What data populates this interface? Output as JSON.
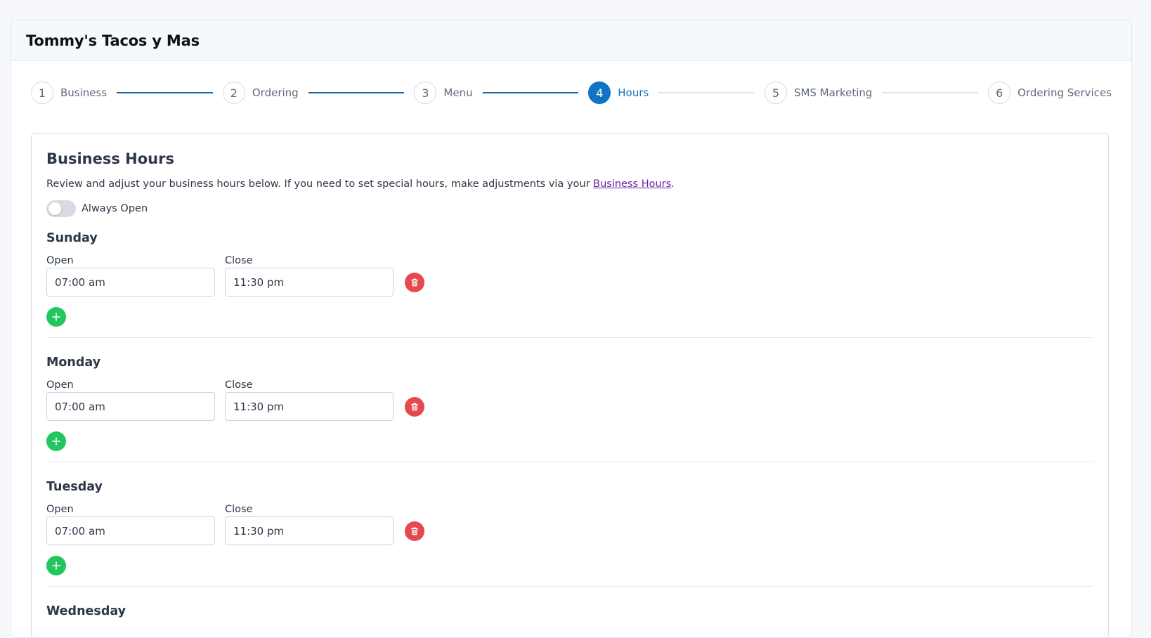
{
  "header": {
    "title": "Tommy's Tacos y Mas"
  },
  "stepper": {
    "steps": [
      {
        "num": "1",
        "label": "Business"
      },
      {
        "num": "2",
        "label": "Ordering"
      },
      {
        "num": "3",
        "label": "Menu"
      },
      {
        "num": "4",
        "label": "Hours"
      },
      {
        "num": "5",
        "label": "SMS Marketing"
      },
      {
        "num": "6",
        "label": "Ordering Services"
      }
    ],
    "active_step": 4
  },
  "card": {
    "title": "Business Hours",
    "description_before": "Review and adjust your business hours below. If you need to set special hours, make adjustments via your ",
    "description_link": "Business Hours",
    "description_after": ".",
    "always_open_label": "Always Open",
    "always_open_on": false,
    "open_label": "Open",
    "close_label": "Close",
    "days": [
      {
        "name": "Sunday",
        "open": "07:00 am",
        "close": "11:30 pm"
      },
      {
        "name": "Monday",
        "open": "07:00 am",
        "close": "11:30 pm"
      },
      {
        "name": "Tuesday",
        "open": "07:00 am",
        "close": "11:30 pm"
      },
      {
        "name": "Wednesday"
      }
    ]
  },
  "colors": {
    "accent": "#1273c4",
    "danger": "#e5484d",
    "success": "#22c55e",
    "link": "#6b21a8"
  },
  "icons": {
    "delete": "trash-icon",
    "add": "plus-icon"
  }
}
